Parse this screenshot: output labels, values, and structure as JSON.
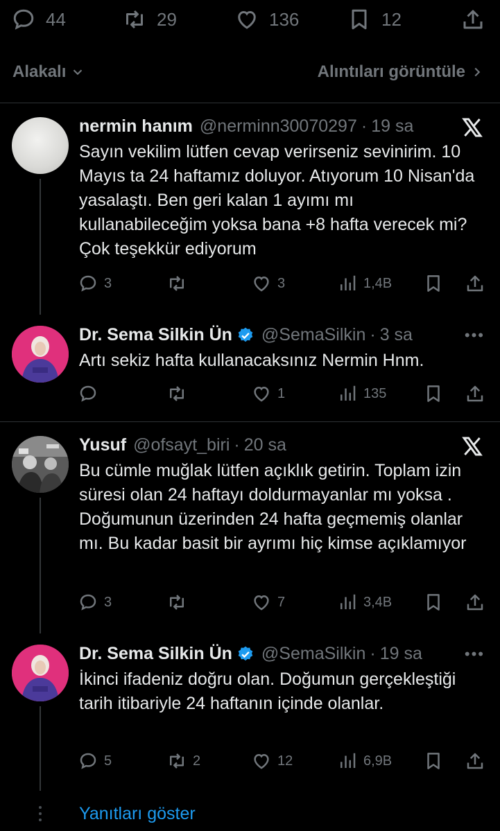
{
  "top_actions": {
    "replies": "44",
    "reposts": "29",
    "likes": "136",
    "bookmarks": "12"
  },
  "sort": {
    "left_label": "Alakalı",
    "right_label": "Alıntıları görüntüle"
  },
  "tweets": [
    {
      "name": "nermin hanım",
      "handle": "@nerminn30070297",
      "time": "19 sa",
      "text": "Sayın vekilim lütfen cevap verirseniz sevinirim. 10 Mayıs ta 24 haftamız doluyor. Atıyorum 10 Nisan'da yasalaştı. Ben geri kalan 1 ayımı mı kullanabileceğim yoksa bana +8 hafta verecek mi? Çok teşekkür ediyorum",
      "replies": "3",
      "reposts": "",
      "likes": "3",
      "views": "1,4B"
    },
    {
      "name": "Dr. Sema Silkin Ün",
      "handle": "@SemaSilkin",
      "time": "3 sa",
      "text": "Artı sekiz hafta kullanacaksınız Nermin Hnm.",
      "replies": "",
      "reposts": "",
      "likes": "1",
      "views": "135"
    },
    {
      "name": "Yusuf",
      "handle": "@ofsayt_biri",
      "time": "20 sa",
      "text": "Bu cümle muğlak lütfen açıklık getirin. Toplam izin süresi olan 24 haftayı doldurmayanlar mı yoksa . Doğumunun üzerinden 24 hafta geçmemiş olanlar mı. Bu kadar basit bir ayrımı hiç kimse açıklamıyor",
      "replies": "3",
      "reposts": "",
      "likes": "7",
      "views": "3,4B"
    },
    {
      "name": "Dr. Sema Silkin Ün",
      "handle": "@SemaSilkin",
      "time": "19 sa",
      "text": "İkinci ifadeniz doğru olan. Doğumun gerçekleştiği tarih itibariyle 24 haftanın içinde olanlar.",
      "replies": "5",
      "reposts": "2",
      "likes": "12",
      "views": "6,9B"
    }
  ],
  "show_replies": "Yanıtları göster",
  "colors": {
    "background": "#000000",
    "text": "#e7e9ea",
    "muted": "#71767b",
    "link": "#1d9bf0",
    "verified": "#1d9bf0",
    "avatar_ring": "#e0307c"
  }
}
